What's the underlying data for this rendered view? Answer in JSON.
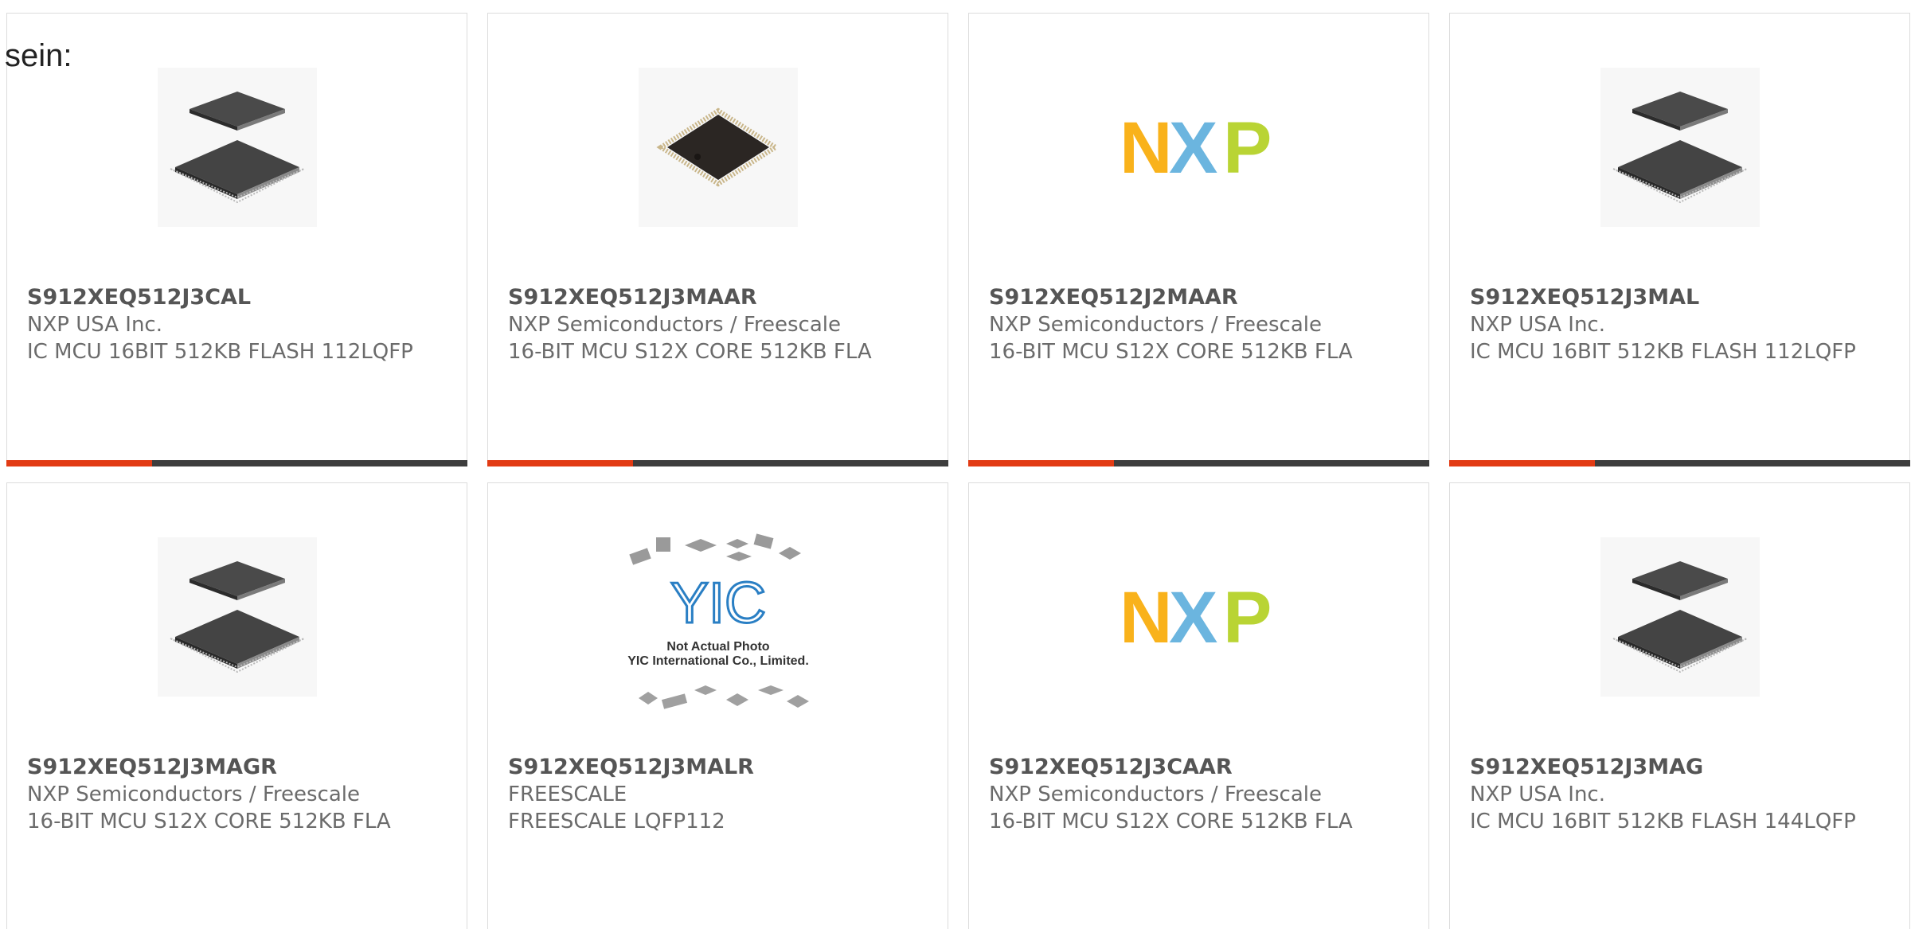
{
  "intro_text": "sein:",
  "colors": {
    "accent": "#e23b14",
    "bar": "#3d3d3d",
    "nxp_orange": "#f9b21b",
    "nxp_blue": "#6bb5df",
    "nxp_green": "#b9d434"
  },
  "nxp_logo": {
    "n": "N",
    "x": "X",
    "p": "P"
  },
  "yic_watermark": {
    "logo": "YIC",
    "line1": "Not Actual Photo",
    "line2": "YIC International Co., Limited."
  },
  "products": [
    {
      "part": "S912XEQ512J3CAL",
      "maker": "NXP USA Inc.",
      "desc": "IC MCU 16BIT 512KB FLASH 112LQFP",
      "image": "qfp-pair-icon"
    },
    {
      "part": "S912XEQ512J3MAAR",
      "maker": "NXP Semiconductors / Freescale",
      "desc": "16-BIT MCU S12X CORE 512KB FLA",
      "image": "qfp-chip-icon"
    },
    {
      "part": "S912XEQ512J2MAAR",
      "maker": "NXP Semiconductors / Freescale",
      "desc": "16-BIT MCU S12X CORE 512KB FLA",
      "image": "nxp-logo"
    },
    {
      "part": "S912XEQ512J3MAL",
      "maker": "NXP USA Inc.",
      "desc": "IC MCU 16BIT 512KB FLASH 112LQFP",
      "image": "qfp-pair-icon"
    },
    {
      "part": "S912XEQ512J3MAGR",
      "maker": "NXP Semiconductors / Freescale",
      "desc": "16-BIT MCU S12X CORE 512KB FLA",
      "image": "qfp-pair-icon"
    },
    {
      "part": "S912XEQ512J3MALR",
      "maker": "FREESCALE",
      "desc": "FREESCALE LQFP112",
      "image": "yic-placeholder"
    },
    {
      "part": "S912XEQ512J3CAAR",
      "maker": "NXP Semiconductors / Freescale",
      "desc": "16-BIT MCU S12X CORE 512KB FLA",
      "image": "nxp-logo"
    },
    {
      "part": "S912XEQ512J3MAG",
      "maker": "NXP USA Inc.",
      "desc": "IC MCU 16BIT 512KB FLASH 144LQFP",
      "image": "qfp-pair-icon"
    }
  ]
}
